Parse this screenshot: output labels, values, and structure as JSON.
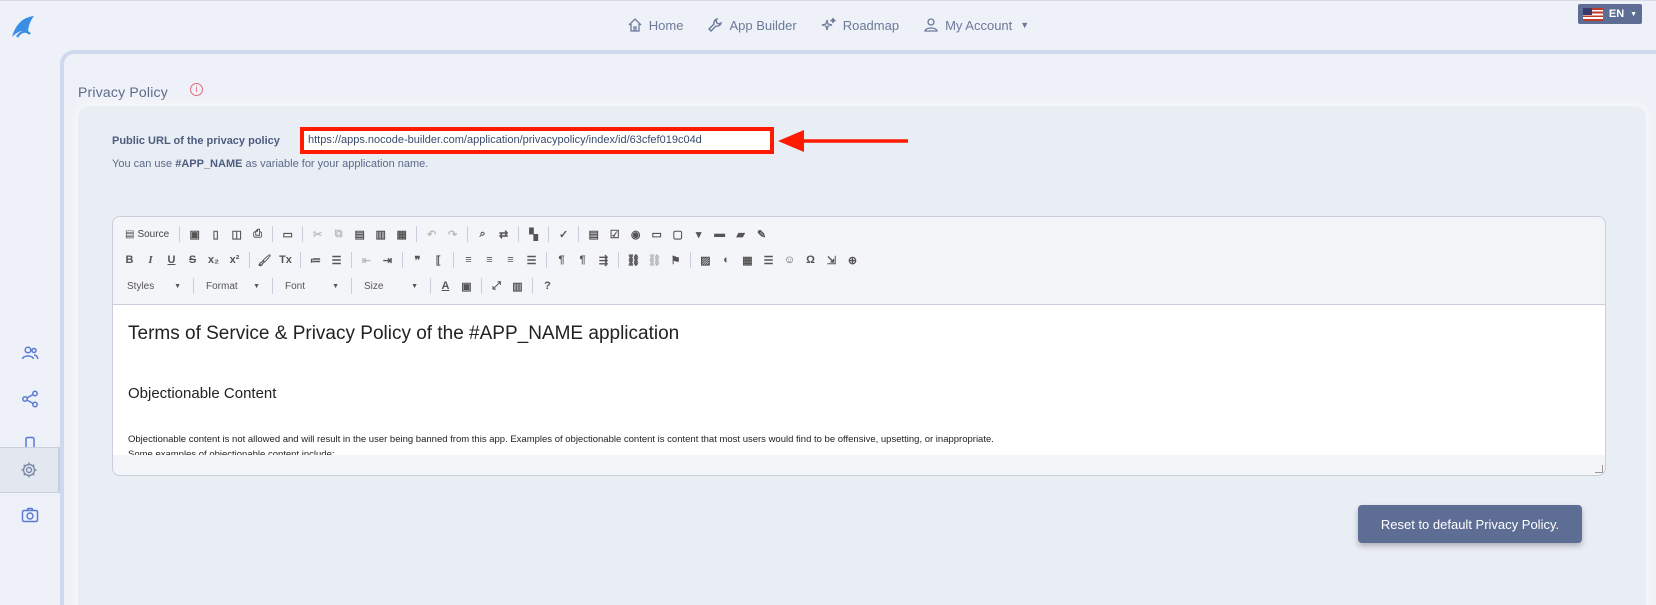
{
  "nav": {
    "home": "Home",
    "app_builder": "App Builder",
    "roadmap": "Roadmap",
    "my_account": "My Account"
  },
  "language": {
    "label": "EN"
  },
  "page": {
    "title": "Privacy Policy",
    "url_label": "Public URL of the privacy policy",
    "url_value": "https://apps.nocode-builder.com/application/privacypolicy/index/id/63cfef019c04d",
    "hint_prefix": "You can use ",
    "hint_var": "#APP_NAME",
    "hint_suffix": " as variable for your application name."
  },
  "editor": {
    "source_label": "Source",
    "combos": [
      "Styles",
      "Format",
      "Font",
      "Size"
    ],
    "heading": "Terms of Service & Privacy Policy of the #APP_NAME application",
    "subheading": "Objectionable Content",
    "paragraph1": "Objectionable content is not allowed and will result in the user being banned from this app. Examples of objectionable content is content that most users would find to be offensive, upsetting, or inappropriate.",
    "paragraph2": "Some examples of objectionable content include:"
  },
  "reset_button": "Reset to default Privacy Policy.",
  "colors": {
    "accent": "#5d6d94",
    "highlight_border": "#ff1a00",
    "icon_blue": "#5b7bd5"
  }
}
